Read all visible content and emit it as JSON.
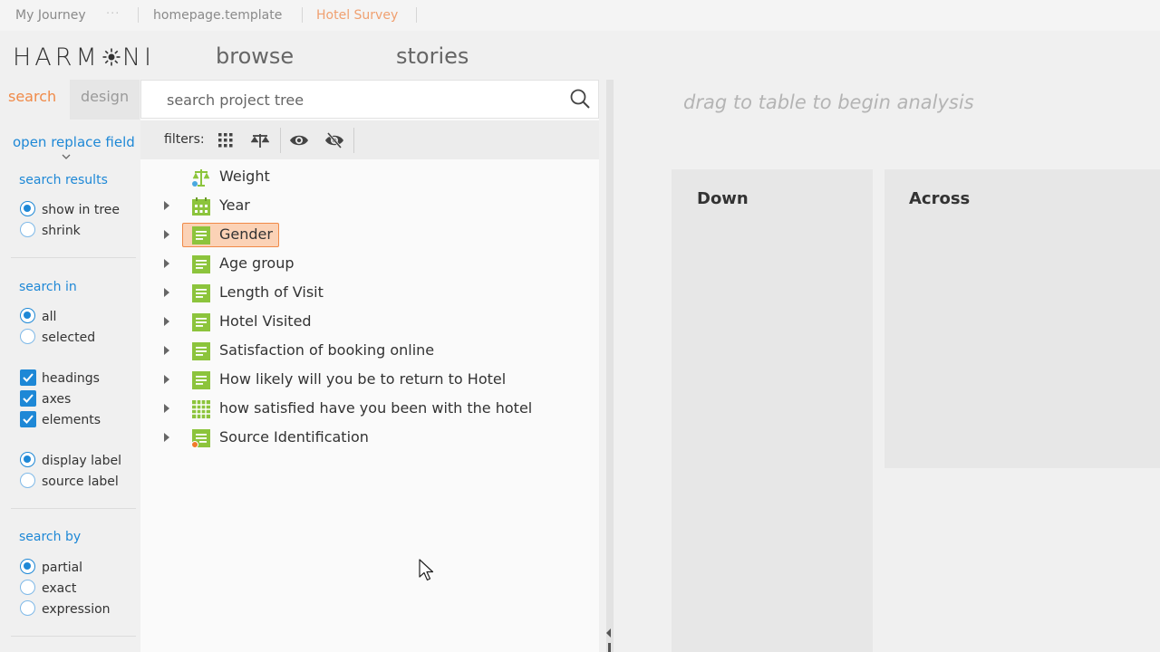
{
  "breadcrumbs": [
    {
      "label": "My Journey"
    },
    {
      "label": "homepage.template"
    },
    {
      "label": "Hotel Survey"
    }
  ],
  "app": {
    "logo_prefix": "HARM",
    "logo_suffix": "NI",
    "nav": [
      {
        "label": "browse"
      },
      {
        "label": "stories"
      }
    ]
  },
  "left_panel": {
    "tabs": [
      {
        "label": "search"
      },
      {
        "label": "design"
      }
    ],
    "open_replace_field": "open replace field",
    "search_results": {
      "heading": "search results",
      "options": [
        {
          "label": "show in tree",
          "selected": true
        },
        {
          "label": "shrink",
          "selected": false
        }
      ]
    },
    "search_in": {
      "heading": "search in",
      "scope": [
        {
          "label": "all",
          "selected": true
        },
        {
          "label": "selected",
          "selected": false
        }
      ],
      "types": [
        {
          "label": "headings",
          "checked": true
        },
        {
          "label": "axes",
          "checked": true
        },
        {
          "label": "elements",
          "checked": true
        }
      ],
      "labels": [
        {
          "label": "display label",
          "selected": true
        },
        {
          "label": "source label",
          "selected": false
        }
      ]
    },
    "search_by": {
      "heading": "search by",
      "options": [
        {
          "label": "partial",
          "selected": true
        },
        {
          "label": "exact",
          "selected": false
        },
        {
          "label": "expression",
          "selected": false
        }
      ]
    }
  },
  "tree": {
    "search_placeholder": "search project tree",
    "filters_label": "filters:",
    "items": [
      {
        "label": "Weight",
        "icon": "weight-icon",
        "expandable": false
      },
      {
        "label": "Year",
        "icon": "calendar-icon",
        "expandable": true
      },
      {
        "label": "Gender",
        "icon": "list-icon",
        "expandable": true,
        "selected": true
      },
      {
        "label": "Age group",
        "icon": "list-icon",
        "expandable": true
      },
      {
        "label": "Length of Visit",
        "icon": "list-icon",
        "expandable": true
      },
      {
        "label": "Hotel Visited",
        "icon": "list-icon",
        "expandable": true
      },
      {
        "label": "Satisfaction of booking online",
        "icon": "list-icon",
        "expandable": true
      },
      {
        "label": "How likely will you be to return to Hotel",
        "icon": "list-icon",
        "expandable": true
      },
      {
        "label": "how satisfied have you been with the hotel",
        "icon": "grid-icon",
        "expandable": true
      },
      {
        "label": "Source Identification",
        "icon": "list-source-icon",
        "expandable": true
      }
    ]
  },
  "analysis": {
    "hint": "drag to table to begin analysis",
    "down_label": "Down",
    "across_label": "Across"
  },
  "colors": {
    "accent": "#1e88d6",
    "active_tab": "#f08a48",
    "tree_icon_green": "#8cc43c",
    "selection_fill": "#fbd2b6"
  }
}
